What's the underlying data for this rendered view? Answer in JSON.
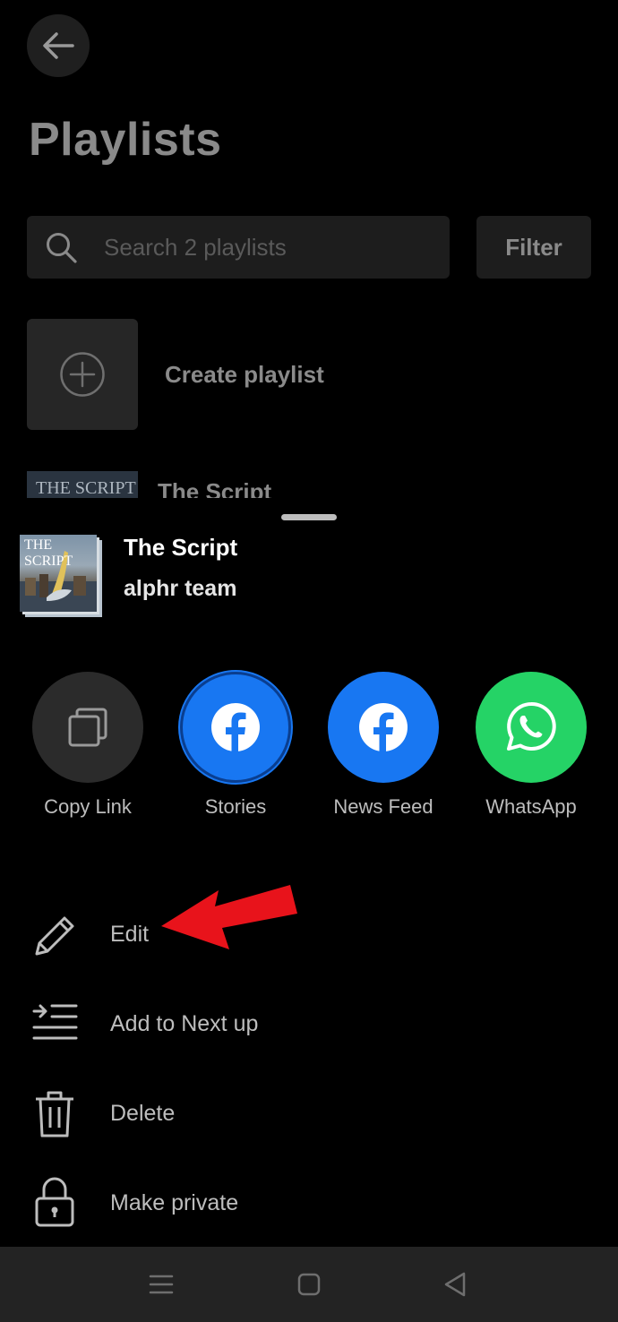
{
  "page": {
    "title": "Playlists"
  },
  "search": {
    "placeholder": "Search 2 playlists"
  },
  "filter": {
    "label": "Filter"
  },
  "create": {
    "label": "Create playlist"
  },
  "background_item": {
    "art_text": "THE SCRIPT",
    "title": "The Script"
  },
  "sheet": {
    "art_text": "THE SCRIPT",
    "title": "The Script",
    "subtitle": "alphr team",
    "share_options": [
      {
        "label": "Copy Link",
        "icon": "copy-icon",
        "color": "#2a2a2a"
      },
      {
        "label": "Stories",
        "icon": "facebook-icon",
        "color": "#1877f2"
      },
      {
        "label": "News Feed",
        "icon": "facebook-icon",
        "color": "#1877f2"
      },
      {
        "label": "WhatsApp",
        "icon": "whatsapp-icon",
        "color": "#25d366"
      }
    ],
    "menu": [
      {
        "label": "Edit",
        "icon": "pencil-icon"
      },
      {
        "label": "Add to Next up",
        "icon": "add-to-queue-icon"
      },
      {
        "label": "Delete",
        "icon": "trash-icon"
      },
      {
        "label": "Make private",
        "icon": "lock-icon"
      }
    ]
  },
  "annotation": {
    "icon": "red-arrow-icon",
    "color": "#e8131b"
  },
  "navbar": {
    "icons": [
      "menu-icon",
      "home-square-icon",
      "back-triangle-icon"
    ]
  }
}
